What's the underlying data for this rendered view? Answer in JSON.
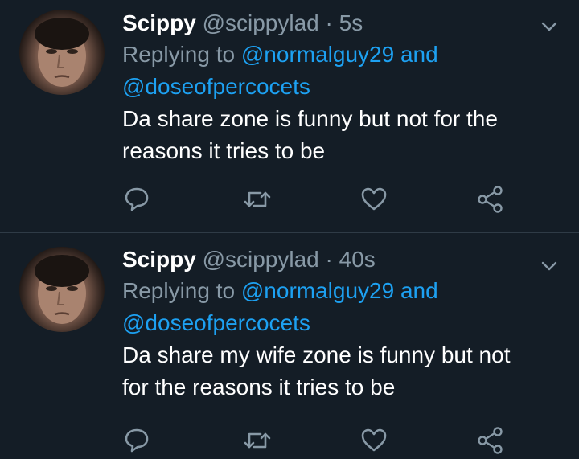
{
  "tweets": [
    {
      "name": "Scippy",
      "handle": "@scippylad",
      "separator": "·",
      "time": "5s",
      "replying_prefix": "Replying to",
      "mention_1": "@normalguy29",
      "mention_joiner": "and",
      "mention_2": "@doseofpercocets",
      "text_line_1": "Da share zone is funny but not for the",
      "text_line_2": "reasons it tries to be"
    },
    {
      "name": "Scippy",
      "handle": "@scippylad",
      "separator": "·",
      "time": "40s",
      "replying_prefix": "Replying to",
      "mention_1": "@normalguy29",
      "mention_joiner": "and",
      "mention_2": "@doseofpercocets",
      "text_line_1": "Da share my wife zone is funny but not",
      "text_line_2": "for the reasons it tries to be"
    }
  ],
  "icons": {
    "reply": "reply-icon",
    "retweet": "retweet-icon",
    "like": "heart-icon",
    "share": "share-icon",
    "more": "chevron-down-icon"
  },
  "colors": {
    "background": "#141d26",
    "muted": "#8899a6",
    "link": "#1da1f2",
    "text": "#ffffff"
  }
}
